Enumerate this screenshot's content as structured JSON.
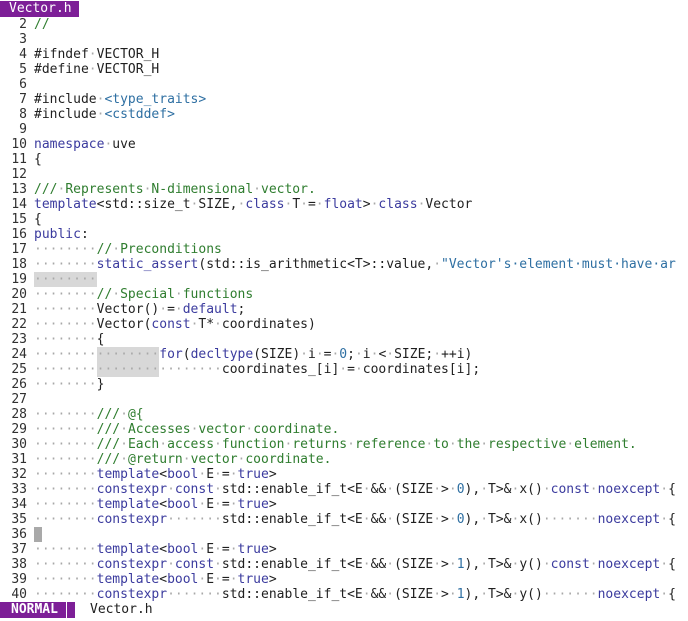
{
  "tabline": {
    "active_tab": "Vector.h"
  },
  "lines": [
    {
      "n": "2",
      "t": "//"
    },
    {
      "n": "3",
      "t": ""
    },
    {
      "n": "4",
      "t": "#ifndef·VECTOR_H"
    },
    {
      "n": "5",
      "t": "#define·VECTOR_H"
    },
    {
      "n": "6",
      "t": ""
    },
    {
      "n": "7",
      "t": "#include·<type_traits>"
    },
    {
      "n": "8",
      "t": "#include·<cstddef>"
    },
    {
      "n": "9",
      "t": ""
    },
    {
      "n": "10",
      "t": "namespace·uve"
    },
    {
      "n": "11",
      "t": "{"
    },
    {
      "n": "12",
      "t": ""
    },
    {
      "n": "13",
      "t": "///·Represents·N-dimensional·vector."
    },
    {
      "n": "14",
      "t": "template<std::size_t·SIZE,·class·T·=·float>·class·Vector"
    },
    {
      "n": "15",
      "t": "{"
    },
    {
      "n": "16",
      "t": "public:"
    },
    {
      "n": "17",
      "t": "········//·Preconditions"
    },
    {
      "n": "18",
      "t": "········static_assert(std::is_arithmetic<T>::value,·\"Vector's·element·must·have·ar"
    },
    {
      "n": "19",
      "t": "········"
    },
    {
      "n": "20",
      "t": "········//·Special·functions"
    },
    {
      "n": "21",
      "t": "········Vector()·=·default;"
    },
    {
      "n": "22",
      "t": "········Vector(const·T*·coordinates)"
    },
    {
      "n": "23",
      "t": "········{"
    },
    {
      "n": "24",
      "t": "················for(decltype(SIZE)·i·=·0;·i·<·SIZE;·++i)"
    },
    {
      "n": "25",
      "t": "························coordinates_[i]·=·coordinates[i];"
    },
    {
      "n": "26",
      "t": "········}"
    },
    {
      "n": "27",
      "t": ""
    },
    {
      "n": "28",
      "t": "········///·@{"
    },
    {
      "n": "29",
      "t": "········///·Accesses·vector·coordinate."
    },
    {
      "n": "30",
      "t": "········///·Each·access·function·returns·reference·to·the·respective·element."
    },
    {
      "n": "31",
      "t": "········///·@return·vector·coordinate."
    },
    {
      "n": "32",
      "t": "········template<bool·E·=·true>"
    },
    {
      "n": "33",
      "t": "········constexpr·const·std::enable_if_t<E·&&·(SIZE·>·0),·T>&·x()·const·noexcept·{"
    },
    {
      "n": "34",
      "t": "········template<bool·E·=·true>"
    },
    {
      "n": "35",
      "t": "········constexpr·······std::enable_if_t<E·&&·(SIZE·>·0),·T>&·x()·······noexcept·{"
    },
    {
      "n": "36",
      "t": ""
    },
    {
      "n": "37",
      "t": "········template<bool·E·=·true>"
    },
    {
      "n": "38",
      "t": "········constexpr·const·std::enable_if_t<E·&&·(SIZE·>·1),·T>&·y()·const·noexcept·{"
    },
    {
      "n": "39",
      "t": "········template<bool·E·=·true>"
    },
    {
      "n": "40",
      "t": "········constexpr·······std::enable_if_t<E·&&·(SIZE·>·1),·T>&·y()·······noexcept·{"
    }
  ],
  "statusline": {
    "mode": "NORMAL",
    "filename": "Vector.h"
  },
  "colors": {
    "accent": "#7d1f97",
    "keyword": "#3b3b9e",
    "comment": "#2f7d2f",
    "string": "#2e6fa2",
    "whitespace": "#a8a8a8"
  }
}
